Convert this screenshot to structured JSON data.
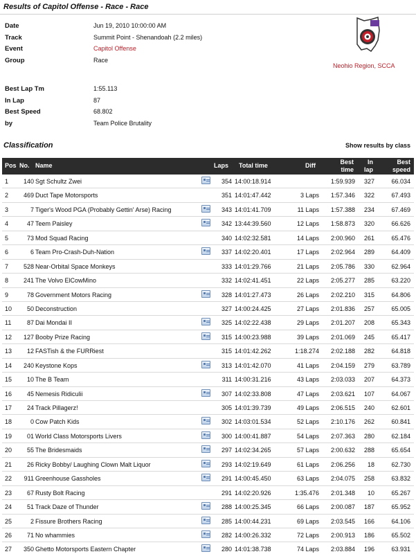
{
  "page": {
    "title": "Results of Capitol Offense - Race - Race"
  },
  "info": [
    {
      "label": "Date",
      "value": "Jun 19, 2010 10:00:00 AM"
    },
    {
      "label": "Track",
      "value": "Summit Point - Shenandoah (2.2 miles)"
    },
    {
      "label": "Event",
      "value": "Capitol Offense"
    },
    {
      "label": "Group",
      "value": "Race"
    }
  ],
  "stats": [
    {
      "label": "Best Lap Tm",
      "value": "1:55.113"
    },
    {
      "label": "In Lap",
      "value": "87"
    },
    {
      "label": "Best Speed",
      "value": "68.802"
    },
    {
      "label": "by",
      "value": "Team Police Brutality"
    }
  ],
  "region": "Neohio Region, SCCA",
  "colors": {
    "accent": "#c0202a",
    "header_bg": "#2c2c2c"
  },
  "classification": {
    "title": "Classification",
    "show_by_class": "Show results by class",
    "headers": {
      "pos": "Pos",
      "no": "No.",
      "name": "Name",
      "laps": "Laps",
      "total": "Total time",
      "diff": "Diff",
      "best_line1": "Best",
      "best_line2": "time",
      "inlap_line1": "In",
      "inlap_line2": "lap",
      "speed_line1": "Best",
      "speed_line2": "speed"
    },
    "rows": [
      {
        "pos": "1",
        "no": "140",
        "name": "Sgt Schultz Zwei",
        "icon": true,
        "laps": "354",
        "total": "14:00:18.914",
        "diff": "",
        "best": "1:59.939",
        "inlap": "327",
        "speed": "66.034"
      },
      {
        "pos": "2",
        "no": "469",
        "name": "Duct Tape Motorsports",
        "icon": false,
        "laps": "351",
        "total": "14:01:47.442",
        "diff": "3 Laps",
        "best": "1:57.346",
        "inlap": "322",
        "speed": "67.493"
      },
      {
        "pos": "3",
        "no": "7",
        "name": "Tiger's Wood PGA (Probably Gettin' Arse) Racing",
        "icon": true,
        "laps": "343",
        "total": "14:01:41.709",
        "diff": "11 Laps",
        "best": "1:57.388",
        "inlap": "234",
        "speed": "67.469"
      },
      {
        "pos": "4",
        "no": "47",
        "name": "Teem Paisley",
        "icon": true,
        "laps": "342",
        "total": "13:44:39.560",
        "diff": "12 Laps",
        "best": "1:58.873",
        "inlap": "320",
        "speed": "66.626"
      },
      {
        "pos": "5",
        "no": "73",
        "name": "Mod Squad Racing",
        "icon": false,
        "laps": "340",
        "total": "14:02:32.581",
        "diff": "14 Laps",
        "best": "2:00.960",
        "inlap": "261",
        "speed": "65.476"
      },
      {
        "pos": "6",
        "no": "6",
        "name": "Team Pro-Crash-Duh-Nation",
        "icon": true,
        "laps": "337",
        "total": "14:02:20.401",
        "diff": "17 Laps",
        "best": "2:02.964",
        "inlap": "289",
        "speed": "64.409"
      },
      {
        "pos": "7",
        "no": "528",
        "name": "Near-Orbital Space Monkeys",
        "icon": false,
        "laps": "333",
        "total": "14:01:29.766",
        "diff": "21 Laps",
        "best": "2:05.786",
        "inlap": "330",
        "speed": "62.964"
      },
      {
        "pos": "8",
        "no": "241",
        "name": "The Volvo ElCowMino",
        "icon": false,
        "laps": "332",
        "total": "14:02:41.451",
        "diff": "22 Laps",
        "best": "2:05.277",
        "inlap": "285",
        "speed": "63.220"
      },
      {
        "pos": "9",
        "no": "78",
        "name": "Government Motors Racing",
        "icon": true,
        "laps": "328",
        "total": "14:01:27.473",
        "diff": "26 Laps",
        "best": "2:02.210",
        "inlap": "315",
        "speed": "64.806"
      },
      {
        "pos": "10",
        "no": "50",
        "name": "Deconstruction",
        "icon": false,
        "laps": "327",
        "total": "14:00:24.425",
        "diff": "27 Laps",
        "best": "2:01.836",
        "inlap": "257",
        "speed": "65.005"
      },
      {
        "pos": "11",
        "no": "87",
        "name": "Dai Mondai II",
        "icon": true,
        "laps": "325",
        "total": "14:02:22.438",
        "diff": "29 Laps",
        "best": "2:01.207",
        "inlap": "208",
        "speed": "65.343"
      },
      {
        "pos": "12",
        "no": "127",
        "name": "Booby Prize Racing",
        "icon": true,
        "laps": "315",
        "total": "14:00:23.988",
        "diff": "39 Laps",
        "best": "2:01.069",
        "inlap": "245",
        "speed": "65.417"
      },
      {
        "pos": "13",
        "no": "12",
        "name": "FASTish & the FURRiest",
        "icon": false,
        "laps": "315",
        "total": "14:01:42.262",
        "diff": "1:18.274",
        "best": "2:02.188",
        "inlap": "282",
        "speed": "64.818"
      },
      {
        "pos": "14",
        "no": "240",
        "name": "Keystone Kops",
        "icon": true,
        "laps": "313",
        "total": "14:01:42.070",
        "diff": "41 Laps",
        "best": "2:04.159",
        "inlap": "279",
        "speed": "63.789"
      },
      {
        "pos": "15",
        "no": "10",
        "name": "The B Team",
        "icon": false,
        "laps": "311",
        "total": "14:00:31.216",
        "diff": "43 Laps",
        "best": "2:03.033",
        "inlap": "207",
        "speed": "64.373"
      },
      {
        "pos": "16",
        "no": "45",
        "name": "Nemesis Ridiculii",
        "icon": true,
        "laps": "307",
        "total": "14:02:33.808",
        "diff": "47 Laps",
        "best": "2:03.621",
        "inlap": "107",
        "speed": "64.067"
      },
      {
        "pos": "17",
        "no": "24",
        "name": "Track Pillagerz!",
        "icon": false,
        "laps": "305",
        "total": "14:01:39.739",
        "diff": "49 Laps",
        "best": "2:06.515",
        "inlap": "240",
        "speed": "62.601"
      },
      {
        "pos": "18",
        "no": "0",
        "name": "Cow Patch Kids",
        "icon": true,
        "laps": "302",
        "total": "14:03:01.534",
        "diff": "52 Laps",
        "best": "2:10.176",
        "inlap": "262",
        "speed": "60.841"
      },
      {
        "pos": "19",
        "no": "01",
        "name": "World Class Motorsports Livers",
        "icon": true,
        "laps": "300",
        "total": "14:00:41.887",
        "diff": "54 Laps",
        "best": "2:07.363",
        "inlap": "280",
        "speed": "62.184"
      },
      {
        "pos": "20",
        "no": "55",
        "name": "The Bridesmaids",
        "icon": true,
        "laps": "297",
        "total": "14:02:34.265",
        "diff": "57 Laps",
        "best": "2:00.632",
        "inlap": "288",
        "speed": "65.654"
      },
      {
        "pos": "21",
        "no": "26",
        "name": "Ricky Bobby/ Laughing Clown Malt Liquor",
        "icon": true,
        "laps": "293",
        "total": "14:02:19.649",
        "diff": "61 Laps",
        "best": "2:06.256",
        "inlap": "18",
        "speed": "62.730"
      },
      {
        "pos": "22",
        "no": "911",
        "name": "Greenhouse Gassholes",
        "icon": true,
        "laps": "291",
        "total": "14:00:45.450",
        "diff": "63 Laps",
        "best": "2:04.075",
        "inlap": "258",
        "speed": "63.832"
      },
      {
        "pos": "23",
        "no": "67",
        "name": "Rusty Bolt Racing",
        "icon": false,
        "laps": "291",
        "total": "14:02:20.926",
        "diff": "1:35.476",
        "best": "2:01.348",
        "inlap": "10",
        "speed": "65.267"
      },
      {
        "pos": "24",
        "no": "51",
        "name": "Track Daze of Thunder",
        "icon": true,
        "laps": "288",
        "total": "14:00:25.345",
        "diff": "66 Laps",
        "best": "2:00.087",
        "inlap": "187",
        "speed": "65.952"
      },
      {
        "pos": "25",
        "no": "2",
        "name": "Fissure Brothers Racing",
        "icon": true,
        "laps": "285",
        "total": "14:00:44.231",
        "diff": "69 Laps",
        "best": "2:03.545",
        "inlap": "166",
        "speed": "64.106"
      },
      {
        "pos": "26",
        "no": "71",
        "name": "No whammies",
        "icon": true,
        "laps": "282",
        "total": "14:00:26.332",
        "diff": "72 Laps",
        "best": "2:00.913",
        "inlap": "186",
        "speed": "65.502"
      },
      {
        "pos": "27",
        "no": "350",
        "name": "Ghetto Motorsports Eastern Chapter",
        "icon": true,
        "laps": "280",
        "total": "14:01:38.738",
        "diff": "74 Laps",
        "best": "2:03.884",
        "inlap": "196",
        "speed": "63.931"
      }
    ]
  }
}
